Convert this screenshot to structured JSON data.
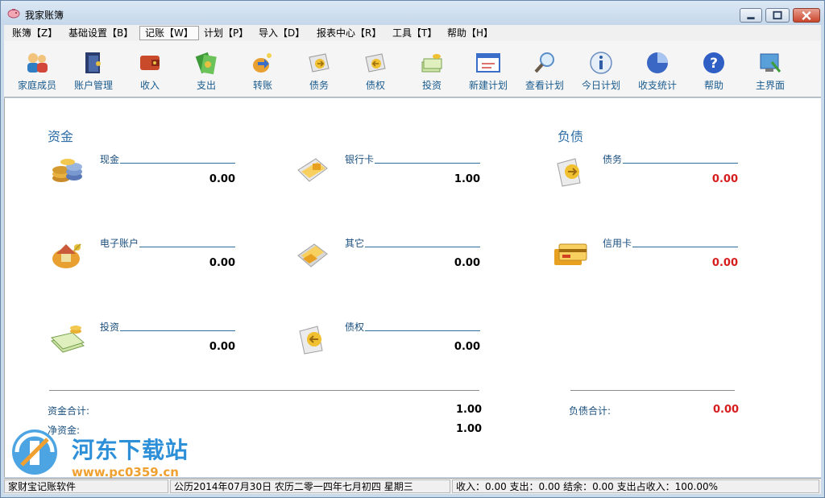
{
  "window": {
    "title": "我家账簿"
  },
  "menu": {
    "items": [
      {
        "label": "账簿【Z】"
      },
      {
        "label": "基础设置【B】"
      },
      {
        "label": "记账【W】"
      },
      {
        "label": "计划【P】"
      },
      {
        "label": "导入【D】"
      },
      {
        "label": "报表中心【R】"
      },
      {
        "label": "工具【T】"
      },
      {
        "label": "帮助【H】"
      }
    ],
    "active_index": 2
  },
  "toolbar": {
    "items": [
      {
        "label": "家庭成员",
        "icon": "family-members-icon"
      },
      {
        "label": "账户管理",
        "icon": "account-management-icon"
      },
      {
        "label": "收入",
        "icon": "income-icon"
      },
      {
        "label": "支出",
        "icon": "expense-icon"
      },
      {
        "label": "转账",
        "icon": "transfer-icon"
      },
      {
        "label": "债务",
        "icon": "debt-icon"
      },
      {
        "label": "债权",
        "icon": "credit-right-icon"
      },
      {
        "label": "投资",
        "icon": "investment-icon"
      },
      {
        "label": "新建计划",
        "icon": "new-plan-icon"
      },
      {
        "label": "查看计划",
        "icon": "view-plan-icon"
      },
      {
        "label": "今日计划",
        "icon": "today-plan-icon"
      },
      {
        "label": "收支统计",
        "icon": "statistics-icon"
      },
      {
        "label": "帮助",
        "icon": "help-icon"
      },
      {
        "label": "主界面",
        "icon": "home-screen-icon"
      }
    ]
  },
  "assets": {
    "title": "资金",
    "entries": [
      {
        "label": "现金",
        "value": "0.00",
        "icon": "cash-coins-icon"
      },
      {
        "label": "银行卡",
        "value": "1.00",
        "icon": "bank-card-icon"
      },
      {
        "label": "电子账户",
        "value": "0.00",
        "icon": "e-account-icon"
      },
      {
        "label": "其它",
        "value": "0.00",
        "icon": "other-assets-icon"
      },
      {
        "label": "投资",
        "value": "0.00",
        "icon": "investment-money-icon"
      },
      {
        "label": "债权",
        "value": "0.00",
        "icon": "credit-right-icon"
      }
    ],
    "total_label": "资金合计:",
    "total_value": "1.00",
    "net_label": "净资金:",
    "net_value": "1.00"
  },
  "liabilities": {
    "title": "负债",
    "entries": [
      {
        "label": "债务",
        "value": "0.00",
        "icon": "debt-icon"
      },
      {
        "label": "信用卡",
        "value": "0.00",
        "icon": "credit-card-icon"
      }
    ],
    "total_label": "负债合计:",
    "total_value": "0.00"
  },
  "status": {
    "app_name": "家财宝记账软件",
    "date": "公历2014年07月30日  农历二零一四年七月初四  星期三",
    "summary": "收入：0.00 支出：0.00 结余：0.00 支出占收入：100.00%"
  },
  "watermark": {
    "line1": "河东下载站",
    "line2": "www.pc0359.cn"
  },
  "colors": {
    "accent": "#2f6ea6",
    "negative_red": "#d61c1c",
    "titlebar": "#c9daea"
  }
}
